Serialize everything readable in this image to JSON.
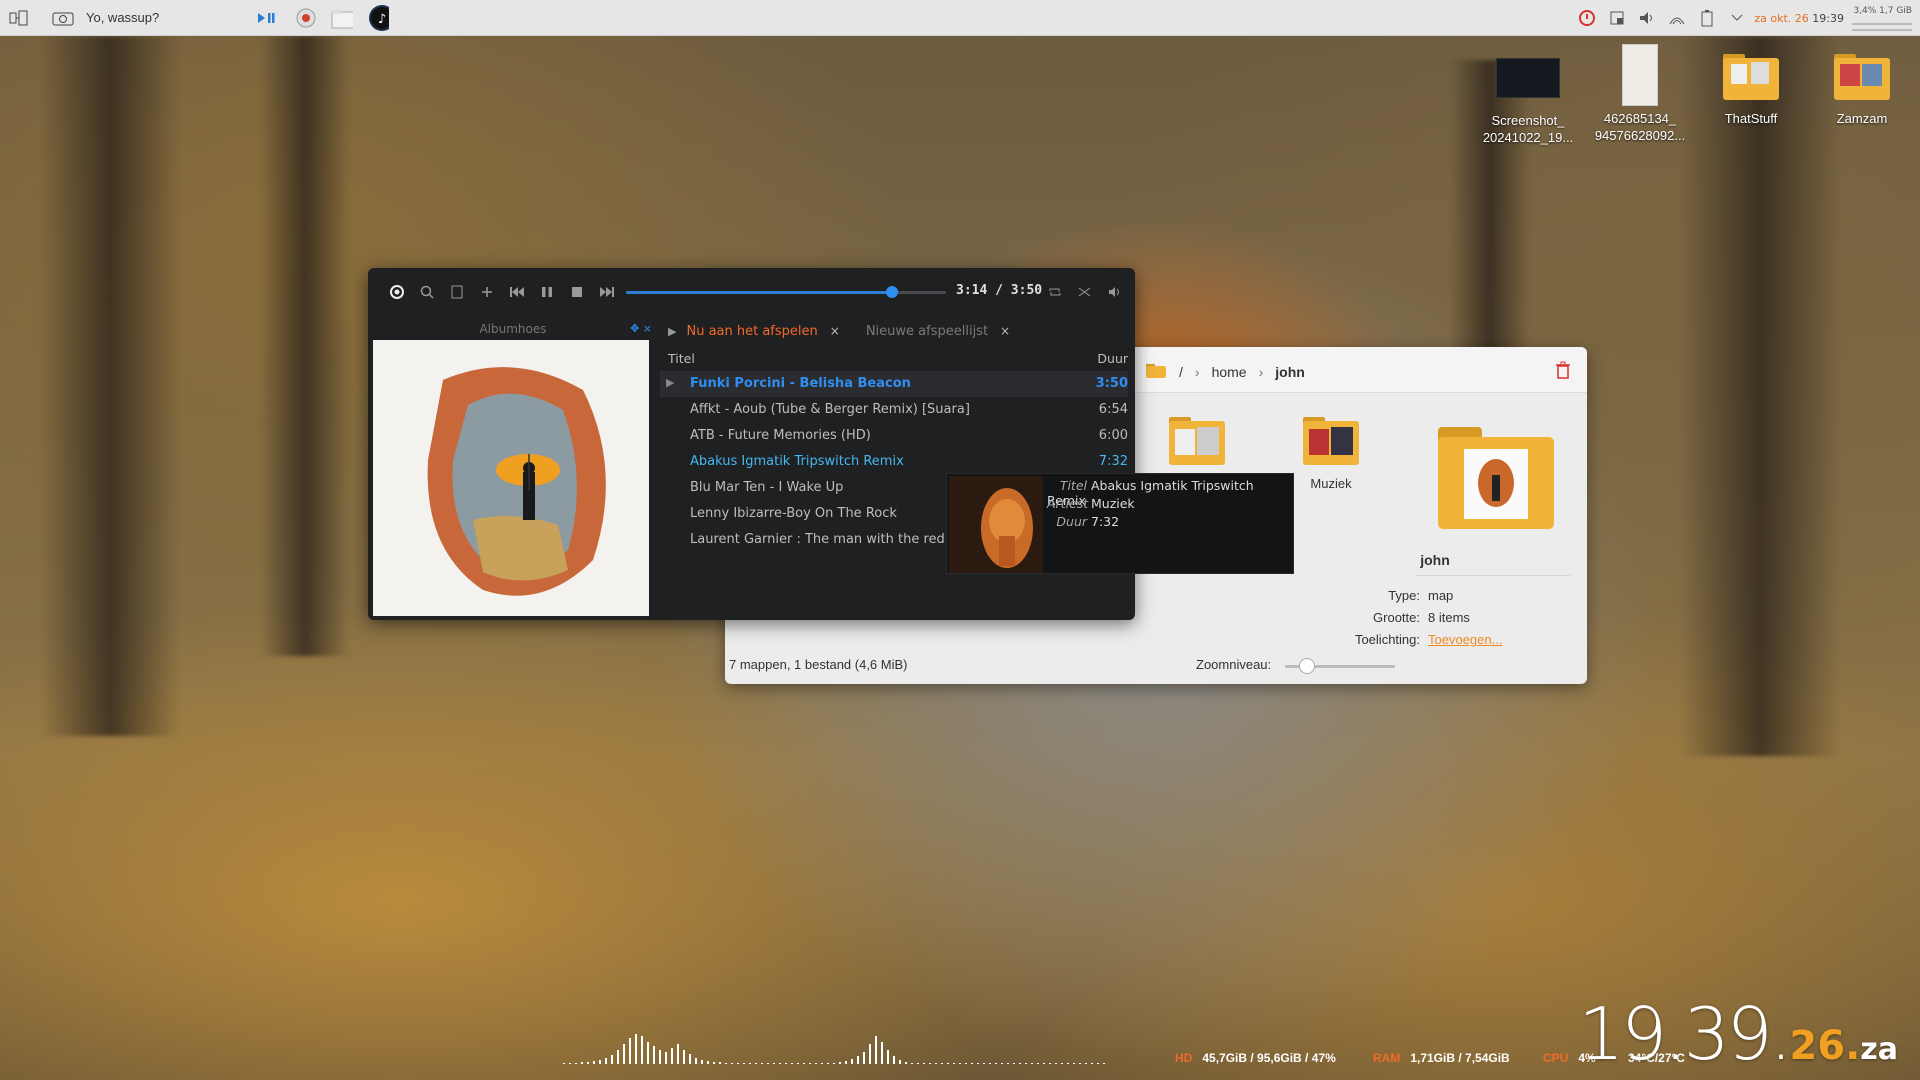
{
  "topbar": {
    "title": "Yo, wassup?",
    "tray_date": "za okt. 26",
    "tray_time": "19:39",
    "mini_stats_line1": "3,4% 1,7 GiB"
  },
  "desktop_icons": [
    {
      "label": "Screenshot_\n20241022_19..."
    },
    {
      "label": "462685134_\n94576628092..."
    },
    {
      "label": "ThatStuff"
    },
    {
      "label": "Zamzam"
    }
  ],
  "player": {
    "time": "3:14 / 3:50",
    "progress_fraction": 0.83,
    "album_pane_title": "Albumhoes",
    "tabs": [
      {
        "label": "Nu aan het afspelen",
        "active": true
      },
      {
        "label": "Nieuwe afspeellijst",
        "active": false
      }
    ],
    "columns": {
      "title": "Titel",
      "duration": "Duur"
    },
    "tracks": [
      {
        "title": "Funki Porcini - Belisha Beacon",
        "duration": "3:50"
      },
      {
        "title": "Affkt - Aoub (Tube & Berger Remix) [Suara]",
        "duration": "6:54"
      },
      {
        "title": "ATB - Future Memories (HD)",
        "duration": "6:00"
      },
      {
        "title": "Abakus Igmatik Tripswitch Remix",
        "duration": "7:32"
      },
      {
        "title": "Blu Mar Ten - I Wake Up",
        "duration": ""
      },
      {
        "title": "Lenny Ibizarre-Boy On The Rock",
        "duration": ""
      },
      {
        "title": "Laurent Garnier :  The man with the red face",
        "duration": ""
      }
    ],
    "tooltip": {
      "title_label": "Titel",
      "title_value": "Abakus Igmatik Tripswitch Remix",
      "artist_label": "Artiest",
      "artist_value": "Muziek",
      "duration_label": "Duur",
      "duration_value": "7:32"
    }
  },
  "file_manager": {
    "breadcrumb": [
      "/",
      "home",
      "john"
    ],
    "folders": [
      {
        "label": ""
      },
      {
        "label": "Muziek"
      }
    ],
    "selected_name": "john",
    "info": [
      {
        "key": "Type:",
        "value": "map"
      },
      {
        "key": "Grootte:",
        "value": "8 items"
      },
      {
        "key": "Toelichting:",
        "value": "Toevoegen..."
      }
    ],
    "status": "7 mappen, 1 bestand (4,6 MiB)",
    "zoom_label": "Zoomniveau:",
    "zoom_fraction": 0.2
  },
  "sysmon": {
    "hd_label": "HD",
    "hd_value": "45,7GiB / 95,6GiB / 47%",
    "ram_label": "RAM",
    "ram_value": "1,71GiB / 7,54GiB",
    "cpu_label": "CPU",
    "cpu_value": "4%",
    "temp_value": "34°C/27°C"
  },
  "big_clock": {
    "hm": "19.39.",
    "s": "26.",
    "day": "za"
  },
  "colors": {
    "accent_orange": "#f06a28",
    "accent_blue": "#2f8ef0",
    "link_orange": "#f08a24"
  }
}
